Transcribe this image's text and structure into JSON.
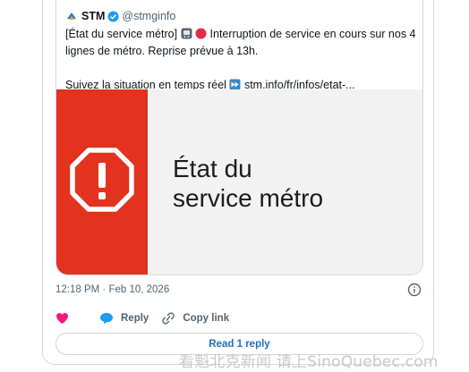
{
  "tweet": {
    "author_name": "STM",
    "author_handle": "@stmginfo",
    "text_line1": "[État du service métro]",
    "text_line1_rest": "Interruption de service en cours sur nos 4",
    "text_line2": "lignes de métro. Reprise prévue à 13h.",
    "text_line4_prefix": "Suivez la situation en temps réel",
    "text_line4_link": "stm.info/fr/infos/etat-...",
    "banner_line1": "État du",
    "banner_line2": "service métro",
    "timestamp": "12:18 PM · Feb 10, 2026"
  },
  "actions": {
    "reply_label": "Reply",
    "copy_link_label": "Copy link",
    "read_replies_label": "Read 1 reply"
  },
  "watermark": "看魁北克新闻 请上SinoQuebec.com",
  "colors": {
    "banner_red": "#e3321d",
    "link_blue": "#1d6fc4",
    "heart_pink": "#f91880",
    "verified_blue": "#1d9bf0"
  },
  "icons": [
    "stm-logo-icon",
    "verified-badge-icon",
    "metro-train-emoji-icon",
    "red-circle-emoji-icon",
    "fast-forward-emoji-icon",
    "warning-icon",
    "info-icon",
    "heart-icon",
    "reply-bubble-icon",
    "link-icon"
  ]
}
